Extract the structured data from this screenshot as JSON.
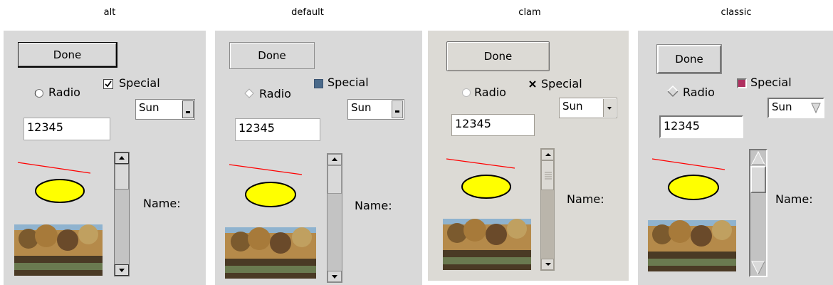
{
  "themes": [
    {
      "id": "alt",
      "title": "alt",
      "button": "Done",
      "radio": "Radio",
      "check": "Special",
      "combo_value": "Sun",
      "entry_value": "12345",
      "name_label": "Name:"
    },
    {
      "id": "default",
      "title": "default",
      "button": "Done",
      "radio": "Radio",
      "check": "Special",
      "combo_value": "Sun",
      "entry_value": "12345",
      "name_label": "Name:"
    },
    {
      "id": "clam",
      "title": "clam",
      "button": "Done",
      "radio": "Radio",
      "check": "Special",
      "combo_value": "Sun",
      "entry_value": "12345",
      "name_label": "Name:"
    },
    {
      "id": "classic",
      "title": "classic",
      "button": "Done",
      "radio": "Radio",
      "check": "Special",
      "combo_value": "Sun",
      "entry_value": "12345",
      "name_label": "Name:"
    }
  ],
  "colors": {
    "panel_bg": "#d9d9d9",
    "clam_panel_bg": "#dcdad5",
    "oval_fill": "#ffff00",
    "line": "#ff0000",
    "default_check": "#4a6a8a",
    "classic_check": "#b03060"
  },
  "icons": {
    "check_checked": "checkmark",
    "clam_check": "x-mark",
    "combo_arrow": "down-arrow",
    "scroll_up": "up-arrow",
    "scroll_down": "down-arrow"
  }
}
